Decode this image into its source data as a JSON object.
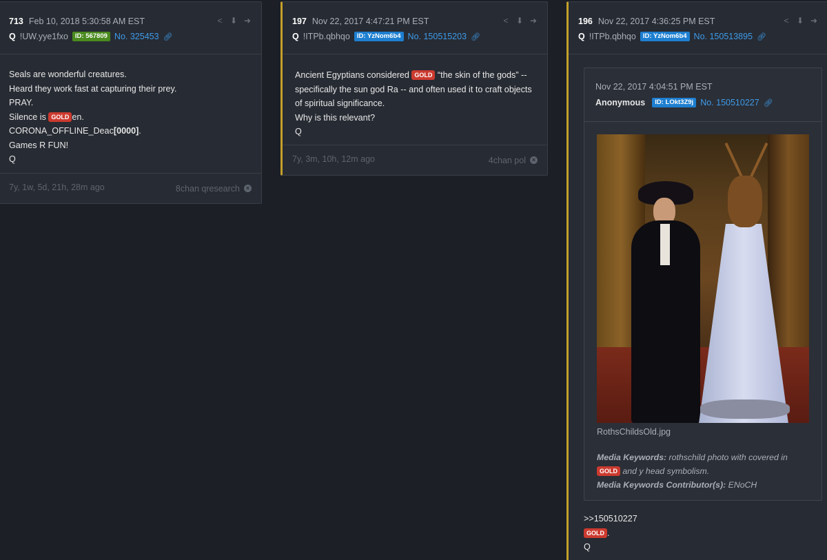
{
  "posts": [
    {
      "num": "713",
      "date": "Feb 10, 2018 5:30:58 AM EST",
      "author": "Q",
      "trip": "!UW.yye1fxo",
      "id": "ID: 567809",
      "postno": "No. 325453",
      "lines": [
        "Seals are wonderful creatures.",
        "Heard they work fast at capturing their prey.",
        "PRAY.",
        "Silence is ",
        "en.",
        "CORONA_OFFLINE_Deac",
        "[0000]",
        ".",
        "Games R FUN!",
        "Q"
      ],
      "age": "7y, 1w, 5d, 21h, 28m ago",
      "source": "8chan qresearch"
    },
    {
      "num": "197",
      "date": "Nov 22, 2017 4:47:21 PM EST",
      "author": "Q",
      "trip": "!ITPb.qbhqo",
      "id": "ID: YzNom6b4",
      "postno": "No. 150515203",
      "text_a": "Ancient Egyptians considered ",
      "text_b": " “the skin of the gods” -- specifically the sun god Ra -- and often used it to craft objects of spiritual significance.",
      "text_c": "Why is this relevant?",
      "text_d": "Q",
      "age": "7y, 3m, 10h, 12m ago",
      "source": "4chan pol"
    },
    {
      "num": "196",
      "date": "Nov 22, 2017 4:36:25 PM EST",
      "author": "Q",
      "trip": "!ITPb.qbhqo",
      "id": "ID: YzNom6b4",
      "postno": "No. 150513895",
      "quote": {
        "date": "Nov 22, 2017 4:04:51 PM EST",
        "author": "Anonymous",
        "id": "ID: LOkt3Z9j",
        "postno": "No. 150510227",
        "filename": "RothsChildsOld.jpg",
        "kw_label": "Media Keywords:",
        "kw_text_a": " rothschild photo with covered in",
        "kw_text_b": " and y head symbolism.",
        "contrib_label": "Media Keywords Contributor(s):",
        "contrib_text": " ENoCH"
      },
      "reply_ref": ">>150510227",
      "reply_end": ".",
      "reply_sig": "Q"
    }
  ],
  "gold_label": "GOLD",
  "colors": {
    "background": "#1c1f26",
    "card": "#272b33",
    "accent_gold_border": "#c4a02a",
    "gold_badge": "#cc3a2f",
    "link": "#3d9bea",
    "id_green": "#4a8a1e",
    "id_blue": "#1e7fd0"
  },
  "icons": [
    "share-icon",
    "download-icon",
    "arrow-right-circle-icon",
    "link-icon",
    "close-circle-icon"
  ]
}
